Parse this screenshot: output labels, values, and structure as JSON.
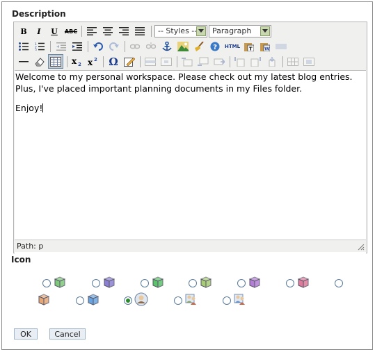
{
  "description_label": "Description",
  "icon_label": "Icon",
  "toolbar": {
    "styles_value": "-- Styles --",
    "format_value": "Paragraph",
    "html_label": "HTML"
  },
  "content": {
    "line1": "Welcome to my personal workspace. Please check out my latest blog entries.",
    "line2": "Plus, I've placed important planning documents in my Files folder.",
    "line3": "Enjoy!"
  },
  "status": {
    "path": "Path: p"
  },
  "buttons": {
    "ok": "OK",
    "cancel": "Cancel"
  },
  "icons": [
    {
      "name": "green-box-icon",
      "color": "#7ec87a",
      "selected": false
    },
    {
      "name": "purple-box-icon",
      "color": "#8b7fd4",
      "selected": false
    },
    {
      "name": "green-box-icon-2",
      "color": "#5cc46a",
      "selected": false
    },
    {
      "name": "olive-box-icon",
      "color": "#a8cc74",
      "selected": false
    },
    {
      "name": "violet-box-icon",
      "color": "#b47ed6",
      "selected": false
    },
    {
      "name": "pink-box-icon",
      "color": "#e07a9a",
      "selected": false
    },
    {
      "name": "none",
      "color": "",
      "selected": false
    },
    {
      "name": "orange-box-icon",
      "color": "#e4a878",
      "selected": false
    },
    {
      "name": "blue-box-icon",
      "color": "#6aa4e0",
      "selected": false
    },
    {
      "name": "person-icon",
      "color": "#8aa0c0",
      "selected": true
    },
    {
      "name": "people-icon",
      "color": "#88a070",
      "selected": false
    },
    {
      "name": "group-globe-icon",
      "color": "#6a90c8",
      "selected": false
    }
  ]
}
